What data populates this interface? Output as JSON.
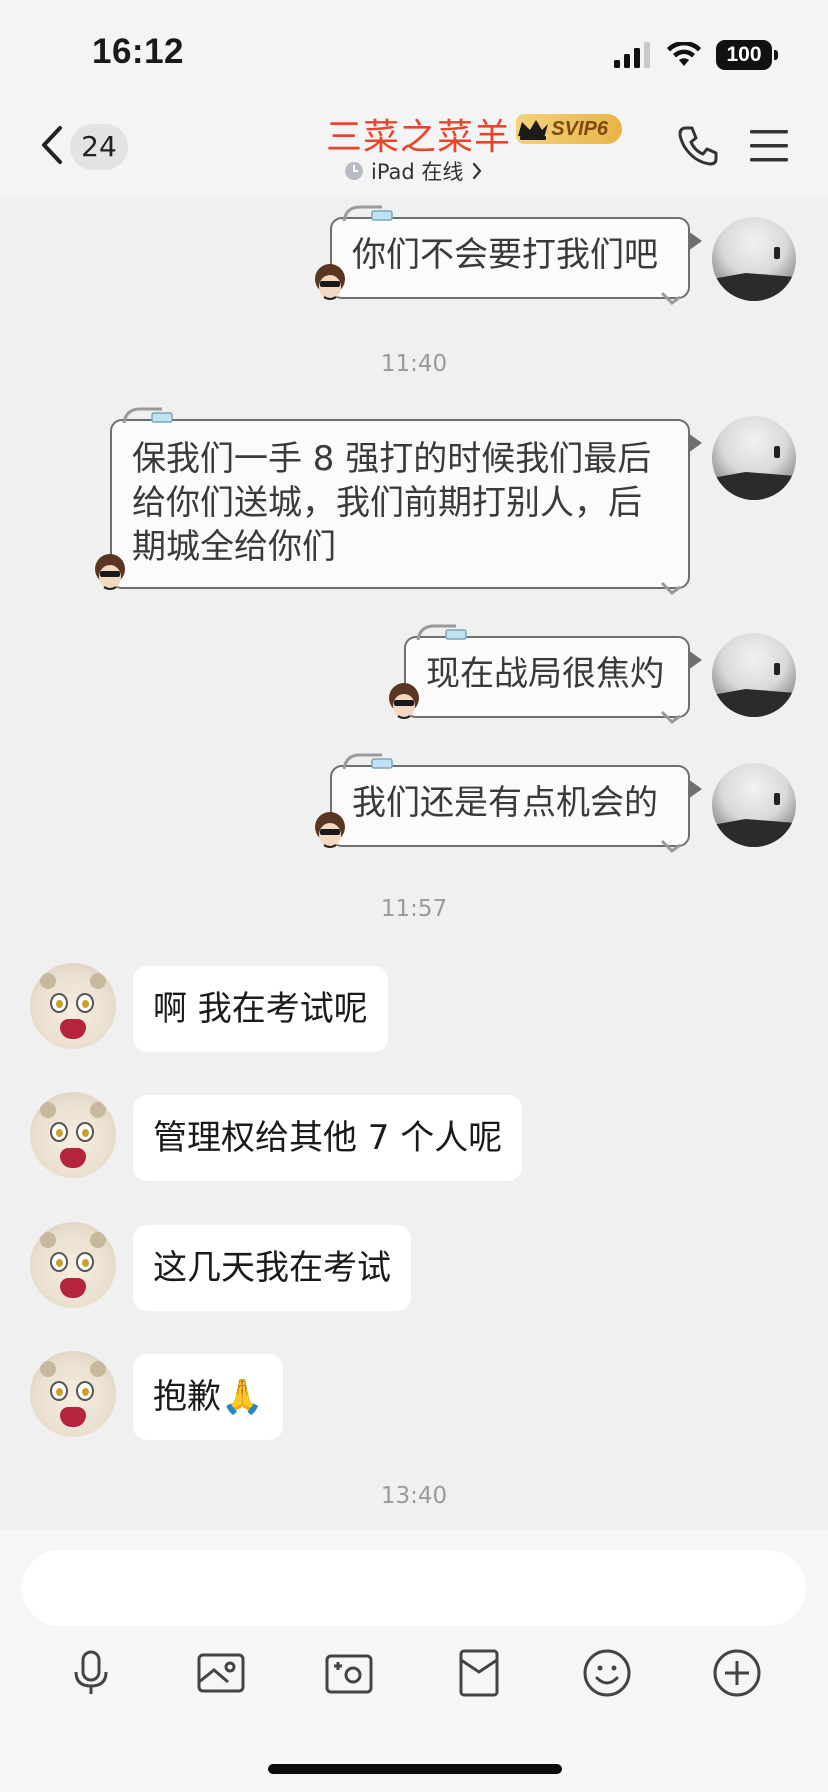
{
  "status_bar": {
    "time": "16:12",
    "battery": "100"
  },
  "header": {
    "unread_count": "24",
    "contact_name": "三菜之菜羊",
    "vip_label": "SVIP6",
    "online_status": "iPad 在线",
    "name_color": "#e8462c"
  },
  "messages": {
    "out_1": "你们不会要打我们吧",
    "time_1": "11:40",
    "out_2_line1": "保我们一手 8 强打的时候我们最后",
    "out_2_line2": "给你们送城，我们前期打别人，后",
    "out_2_line3": "期城全给你们",
    "out_3": "现在战局很焦灼",
    "out_4": "我们还是有点机会的",
    "time_2": "11:57",
    "in_1": "啊 我在考试呢",
    "in_2": "管理权给其他 7 个人呢",
    "in_3": "这几天我在考试",
    "in_4": "抱歉🙏",
    "time_3": "13:40"
  },
  "input": {
    "placeholder": ""
  },
  "toolbar": {
    "icons": [
      "microphone-icon",
      "image-icon",
      "camera-icon",
      "red-packet-icon",
      "emoji-icon",
      "plus-icon"
    ]
  }
}
